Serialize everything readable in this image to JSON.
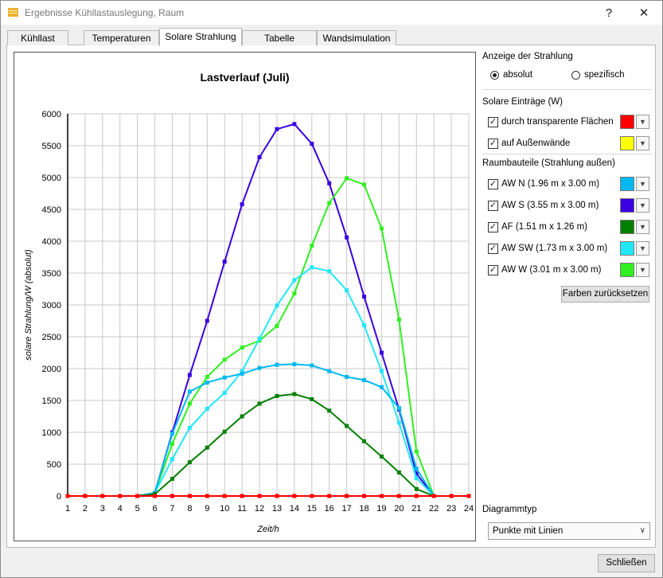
{
  "window": {
    "title": "Ergebnisse Kühllastauslegung, Raum",
    "help": "?",
    "close": "✕"
  },
  "tabs": [
    {
      "label": "Kühllast"
    },
    {
      "label": "Temperaturen"
    },
    {
      "label": "Solare Strahlung"
    },
    {
      "label": "Tabelle"
    },
    {
      "label": "Wandsimulation"
    }
  ],
  "active_tab": "Solare Strahlung",
  "panel": {
    "display_label": "Anzeige der Strahlung",
    "radio_absolut": "absolut",
    "radio_spezifisch": "spezifisch",
    "selected_mode": "absolut",
    "solar_label": "Solare Einträge (W)",
    "solar_items": [
      {
        "label": "durch transparente Flächen",
        "checked": true,
        "color": "#ff0000"
      },
      {
        "label": "auf Außenwände",
        "checked": true,
        "color": "#ffff00"
      }
    ],
    "components_label": "Raumbauteile (Strahlung außen)",
    "components": [
      {
        "label": "AW N (1.96 m x 3.00 m)",
        "checked": true,
        "color": "#00b8f0"
      },
      {
        "label": "AW S (3.55 m x 3.00 m)",
        "checked": true,
        "color": "#3a00e0"
      },
      {
        "label": "AF (1.51 m x 1.26 m)",
        "checked": true,
        "color": "#008000"
      },
      {
        "label": "AW SW (1.73 m x 3.00 m)",
        "checked": true,
        "color": "#20e8f8"
      },
      {
        "label": "AW W (3.01 m x 3.00 m)",
        "checked": true,
        "color": "#30f020"
      }
    ],
    "reset_button": "Farben zurücksetzen",
    "diagram_type_label": "Diagrammtyp",
    "diagram_type_value": "Punkte mit Linien"
  },
  "footer": {
    "close_button": "Schließen"
  },
  "chart_data": {
    "type": "line",
    "title": "Lastverlauf (Juli)",
    "xlabel": "Zeit/h",
    "ylabel": "solare Strahlung/W (absolut)",
    "x": [
      1,
      2,
      3,
      4,
      5,
      6,
      7,
      8,
      9,
      10,
      11,
      12,
      13,
      14,
      15,
      16,
      17,
      18,
      19,
      20,
      21,
      22,
      23,
      24
    ],
    "xlim": [
      1,
      24
    ],
    "ylim": [
      0,
      6000
    ],
    "yticks": [
      0,
      500,
      1000,
      1500,
      2000,
      2500,
      3000,
      3500,
      4000,
      4500,
      5000,
      5500,
      6000
    ],
    "grid": true,
    "series": [
      {
        "name": "AW S (3.55 m x 3.00 m)",
        "color": "#3a00e0",
        "values": [
          0,
          0,
          0,
          0,
          0,
          50,
          1000,
          1900,
          2750,
          3680,
          4580,
          5320,
          5760,
          5840,
          5530,
          4910,
          4060,
          3130,
          2250,
          1360,
          350,
          0,
          0,
          0
        ]
      },
      {
        "name": "AW W (3.01 m x 3.00 m)",
        "color": "#30f020",
        "values": [
          0,
          0,
          0,
          0,
          0,
          50,
          820,
          1450,
          1870,
          2140,
          2330,
          2440,
          2670,
          3180,
          3930,
          4600,
          4990,
          4890,
          4200,
          2770,
          700,
          0,
          0,
          0
        ]
      },
      {
        "name": "AW SW (1.73 m x 3.00 m)",
        "color": "#20e8f8",
        "values": [
          0,
          0,
          0,
          0,
          0,
          50,
          580,
          1070,
          1370,
          1620,
          1960,
          2470,
          2990,
          3390,
          3590,
          3530,
          3230,
          2680,
          1960,
          1150,
          280,
          0,
          0,
          0
        ]
      },
      {
        "name": "AW N (1.96 m x 3.00 m)",
        "color": "#00b8f0",
        "values": [
          0,
          0,
          0,
          0,
          0,
          50,
          980,
          1640,
          1780,
          1860,
          1920,
          2010,
          2060,
          2070,
          2050,
          1960,
          1870,
          1820,
          1710,
          1380,
          430,
          0,
          0,
          0
        ]
      },
      {
        "name": "AF (1.51 m x 1.26 m)",
        "color": "#008000",
        "values": [
          0,
          0,
          0,
          0,
          0,
          30,
          270,
          530,
          760,
          1010,
          1250,
          1450,
          1570,
          1600,
          1520,
          1340,
          1100,
          860,
          620,
          370,
          110,
          0,
          0,
          0
        ]
      },
      {
        "name": "auf Außenwände",
        "color": "#ffff00",
        "values": [
          0,
          0,
          0,
          0,
          0,
          0,
          0,
          0,
          0,
          0,
          0,
          0,
          0,
          0,
          0,
          0,
          0,
          0,
          0,
          0,
          0,
          0,
          0,
          0
        ]
      },
      {
        "name": "durch transparente Flächen",
        "color": "#ff0000",
        "values": [
          0,
          0,
          0,
          0,
          0,
          0,
          0,
          0,
          0,
          0,
          0,
          0,
          0,
          0,
          0,
          0,
          0,
          0,
          0,
          0,
          0,
          0,
          0,
          0
        ]
      }
    ]
  }
}
